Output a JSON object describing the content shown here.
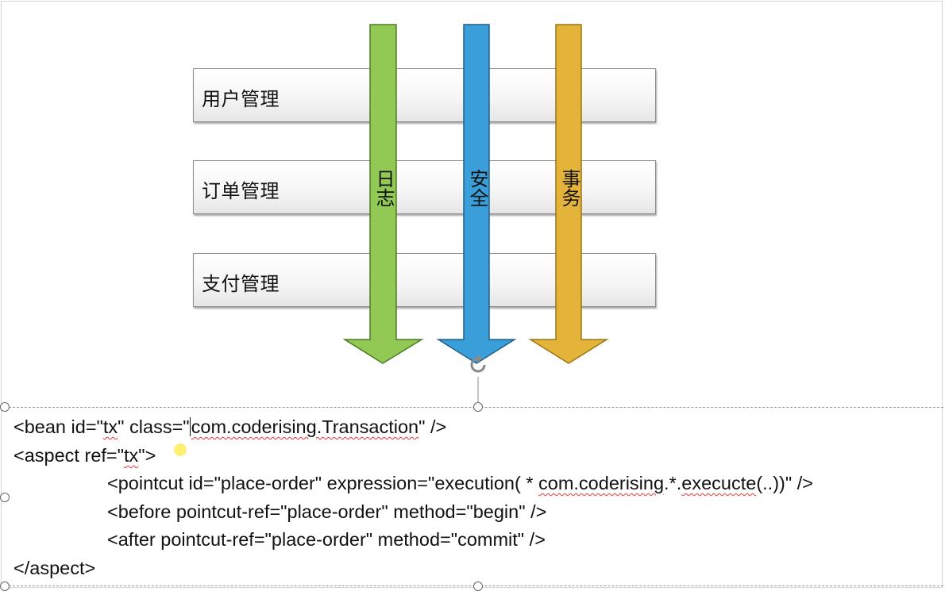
{
  "modules": [
    {
      "label": "用户管理"
    },
    {
      "label": "订单管理"
    },
    {
      "label": "支付管理"
    }
  ],
  "aspects": [
    {
      "label": "日志",
      "color": "#92c954",
      "stroke": "#4e7a25"
    },
    {
      "label": "安全",
      "color": "#3a9fd8",
      "stroke": "#1f5f8a"
    },
    {
      "label": "事务",
      "color": "#e4b43a",
      "stroke": "#9c7414"
    }
  ],
  "code": {
    "line1": {
      "prefix": "<bean id=\"",
      "tx": "tx",
      "mid": "\" class=\"",
      "class_name": "com.coderising.Transaction",
      "suffix": "\" />"
    },
    "line2": {
      "prefix": "<aspect ref=\"",
      "tx": "tx",
      "suffix": "\">"
    },
    "line3": {
      "prefix": "<pointcut id=\"place-order\" expression=\"execution( * ",
      "pkg": "com.coderising",
      "dot_star": ".*.",
      "method": "execucte",
      "suffix": "(..))\" />"
    },
    "line4": "<before pointcut-ref=\"place-order\" method=\"begin\" />",
    "line5": "<after pointcut-ref=\"place-order\" method=\"commit\" />",
    "line6": "</aspect>"
  }
}
